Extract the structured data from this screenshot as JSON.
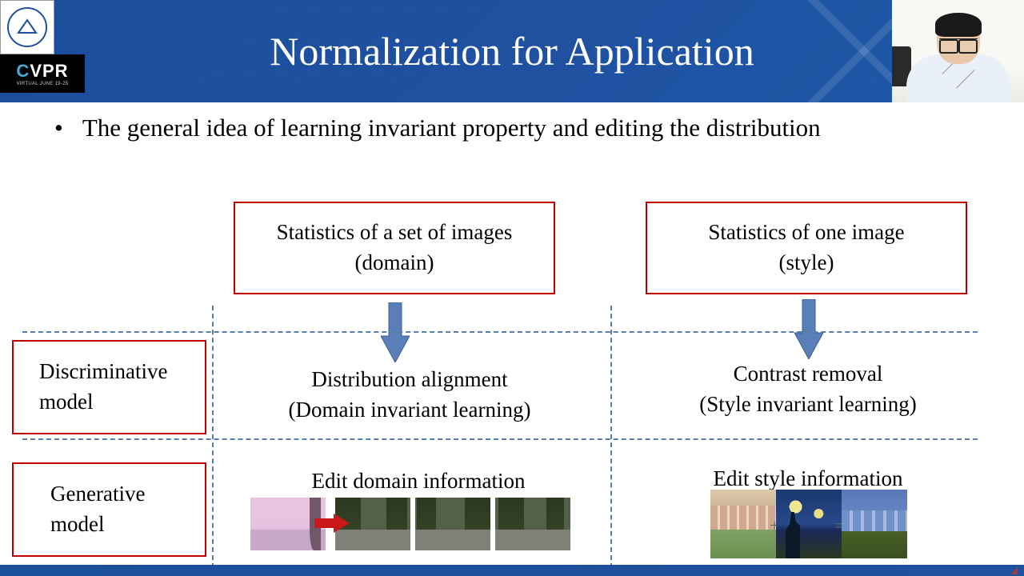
{
  "header": {
    "title": "Normalization for Application"
  },
  "logo": {
    "university_alt": "Beihang University",
    "cvpr": "CVPR",
    "cvpr_sub": "VIRTUAL JUNE 19-25"
  },
  "bullet": {
    "dot": "•",
    "text": "The general idea of learning invariant property and editing the distribution"
  },
  "columns": {
    "left": {
      "top_line1": "Statistics of a set of images",
      "top_line2": "(domain)"
    },
    "right": {
      "top_line1": "Statistics  of one image",
      "top_line2": "(style)"
    }
  },
  "rows": {
    "discriminative": {
      "label_line1": "Discriminative",
      "label_line2": "model",
      "left_line1": "Distribution alignment",
      "left_line2": "(Domain invariant learning)",
      "right_line1": "Contrast removal",
      "right_line2": "(Style invariant learning)"
    },
    "generative": {
      "label_line1": "Generative",
      "label_line2": "model",
      "left_title": "Edit domain information",
      "right_title": "Edit style information"
    }
  },
  "icons": {
    "arrow_down": "arrow-down",
    "arrow_right": "arrow-right"
  }
}
